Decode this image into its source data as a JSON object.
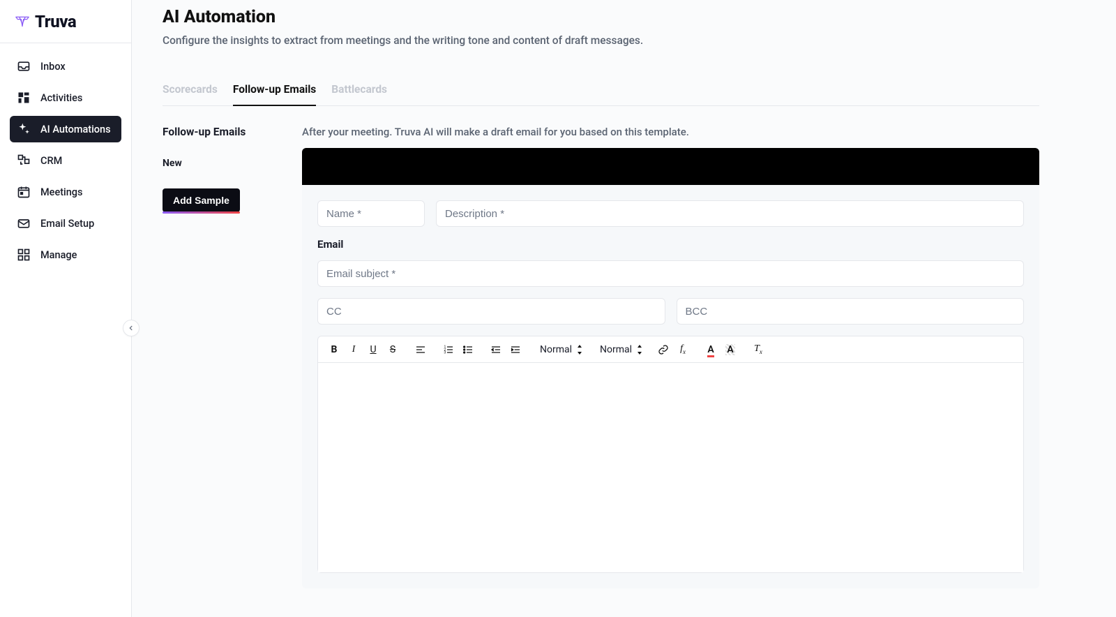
{
  "brand": {
    "name": "Truva"
  },
  "sidebar": {
    "items": [
      {
        "label": "Inbox"
      },
      {
        "label": "Activities"
      },
      {
        "label": "AI Automations"
      },
      {
        "label": "CRM"
      },
      {
        "label": "Meetings"
      },
      {
        "label": "Email Setup"
      },
      {
        "label": "Manage"
      }
    ]
  },
  "page": {
    "title": "AI Automation",
    "subtitle": "Configure the insights to extract from meetings and the writing tone and content of draft messages."
  },
  "tabs": [
    {
      "label": "Scorecards"
    },
    {
      "label": "Follow-up Emails"
    },
    {
      "label": "Battlecards"
    }
  ],
  "left": {
    "heading": "Follow-up Emails",
    "subitem": "New",
    "add_sample": "Add Sample"
  },
  "right": {
    "hint": "After your meeting. Truva AI will make a draft email for you based on this template.",
    "placeholders": {
      "name": "Name *",
      "description": "Description *",
      "subject": "Email subject *",
      "cc": "CC",
      "bcc": "BCC"
    },
    "section_email": "Email",
    "toolbar": {
      "heading_select": "Normal",
      "size_select": "Normal"
    }
  }
}
